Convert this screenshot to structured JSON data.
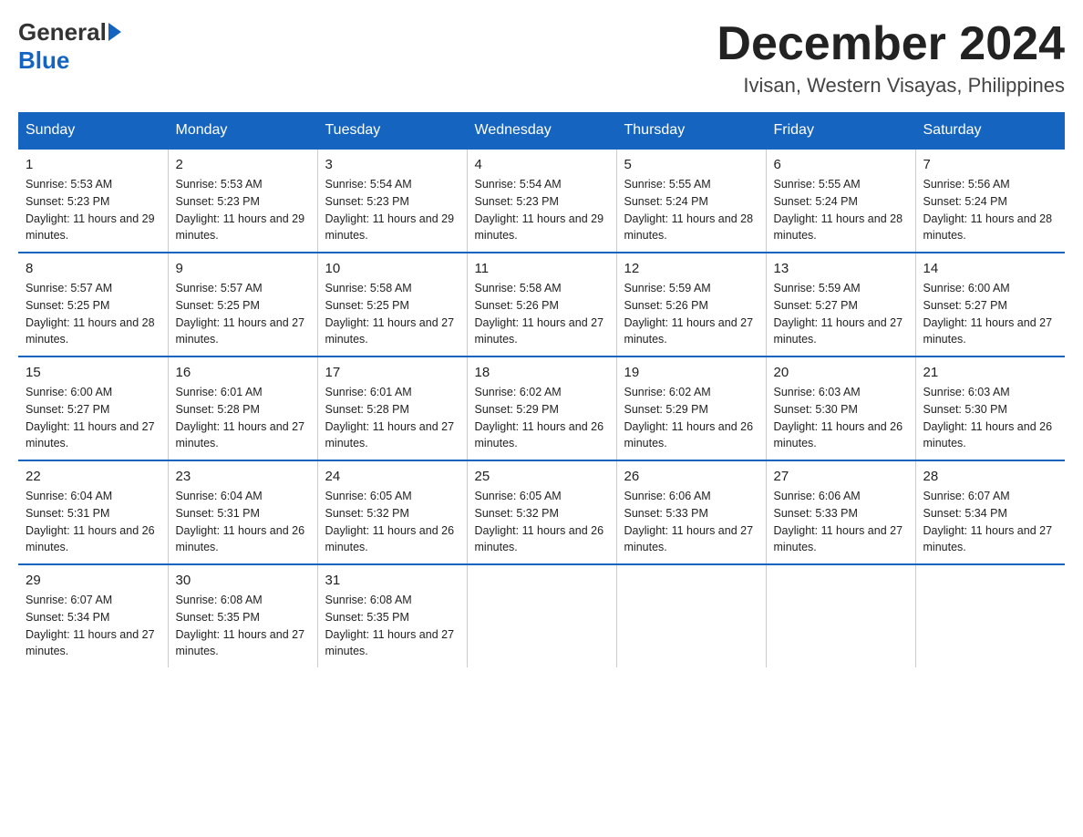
{
  "logo": {
    "general": "General",
    "blue": "Blue"
  },
  "header": {
    "month": "December 2024",
    "location": "Ivisan, Western Visayas, Philippines"
  },
  "days_of_week": [
    "Sunday",
    "Monday",
    "Tuesday",
    "Wednesday",
    "Thursday",
    "Friday",
    "Saturday"
  ],
  "weeks": [
    [
      {
        "day": "1",
        "sunrise": "5:53 AM",
        "sunset": "5:23 PM",
        "daylight": "11 hours and 29 minutes."
      },
      {
        "day": "2",
        "sunrise": "5:53 AM",
        "sunset": "5:23 PM",
        "daylight": "11 hours and 29 minutes."
      },
      {
        "day": "3",
        "sunrise": "5:54 AM",
        "sunset": "5:23 PM",
        "daylight": "11 hours and 29 minutes."
      },
      {
        "day": "4",
        "sunrise": "5:54 AM",
        "sunset": "5:23 PM",
        "daylight": "11 hours and 29 minutes."
      },
      {
        "day": "5",
        "sunrise": "5:55 AM",
        "sunset": "5:24 PM",
        "daylight": "11 hours and 28 minutes."
      },
      {
        "day": "6",
        "sunrise": "5:55 AM",
        "sunset": "5:24 PM",
        "daylight": "11 hours and 28 minutes."
      },
      {
        "day": "7",
        "sunrise": "5:56 AM",
        "sunset": "5:24 PM",
        "daylight": "11 hours and 28 minutes."
      }
    ],
    [
      {
        "day": "8",
        "sunrise": "5:57 AM",
        "sunset": "5:25 PM",
        "daylight": "11 hours and 28 minutes."
      },
      {
        "day": "9",
        "sunrise": "5:57 AM",
        "sunset": "5:25 PM",
        "daylight": "11 hours and 27 minutes."
      },
      {
        "day": "10",
        "sunrise": "5:58 AM",
        "sunset": "5:25 PM",
        "daylight": "11 hours and 27 minutes."
      },
      {
        "day": "11",
        "sunrise": "5:58 AM",
        "sunset": "5:26 PM",
        "daylight": "11 hours and 27 minutes."
      },
      {
        "day": "12",
        "sunrise": "5:59 AM",
        "sunset": "5:26 PM",
        "daylight": "11 hours and 27 minutes."
      },
      {
        "day": "13",
        "sunrise": "5:59 AM",
        "sunset": "5:27 PM",
        "daylight": "11 hours and 27 minutes."
      },
      {
        "day": "14",
        "sunrise": "6:00 AM",
        "sunset": "5:27 PM",
        "daylight": "11 hours and 27 minutes."
      }
    ],
    [
      {
        "day": "15",
        "sunrise": "6:00 AM",
        "sunset": "5:27 PM",
        "daylight": "11 hours and 27 minutes."
      },
      {
        "day": "16",
        "sunrise": "6:01 AM",
        "sunset": "5:28 PM",
        "daylight": "11 hours and 27 minutes."
      },
      {
        "day": "17",
        "sunrise": "6:01 AM",
        "sunset": "5:28 PM",
        "daylight": "11 hours and 27 minutes."
      },
      {
        "day": "18",
        "sunrise": "6:02 AM",
        "sunset": "5:29 PM",
        "daylight": "11 hours and 26 minutes."
      },
      {
        "day": "19",
        "sunrise": "6:02 AM",
        "sunset": "5:29 PM",
        "daylight": "11 hours and 26 minutes."
      },
      {
        "day": "20",
        "sunrise": "6:03 AM",
        "sunset": "5:30 PM",
        "daylight": "11 hours and 26 minutes."
      },
      {
        "day": "21",
        "sunrise": "6:03 AM",
        "sunset": "5:30 PM",
        "daylight": "11 hours and 26 minutes."
      }
    ],
    [
      {
        "day": "22",
        "sunrise": "6:04 AM",
        "sunset": "5:31 PM",
        "daylight": "11 hours and 26 minutes."
      },
      {
        "day": "23",
        "sunrise": "6:04 AM",
        "sunset": "5:31 PM",
        "daylight": "11 hours and 26 minutes."
      },
      {
        "day": "24",
        "sunrise": "6:05 AM",
        "sunset": "5:32 PM",
        "daylight": "11 hours and 26 minutes."
      },
      {
        "day": "25",
        "sunrise": "6:05 AM",
        "sunset": "5:32 PM",
        "daylight": "11 hours and 26 minutes."
      },
      {
        "day": "26",
        "sunrise": "6:06 AM",
        "sunset": "5:33 PM",
        "daylight": "11 hours and 27 minutes."
      },
      {
        "day": "27",
        "sunrise": "6:06 AM",
        "sunset": "5:33 PM",
        "daylight": "11 hours and 27 minutes."
      },
      {
        "day": "28",
        "sunrise": "6:07 AM",
        "sunset": "5:34 PM",
        "daylight": "11 hours and 27 minutes."
      }
    ],
    [
      {
        "day": "29",
        "sunrise": "6:07 AM",
        "sunset": "5:34 PM",
        "daylight": "11 hours and 27 minutes."
      },
      {
        "day": "30",
        "sunrise": "6:08 AM",
        "sunset": "5:35 PM",
        "daylight": "11 hours and 27 minutes."
      },
      {
        "day": "31",
        "sunrise": "6:08 AM",
        "sunset": "5:35 PM",
        "daylight": "11 hours and 27 minutes."
      },
      null,
      null,
      null,
      null
    ]
  ]
}
